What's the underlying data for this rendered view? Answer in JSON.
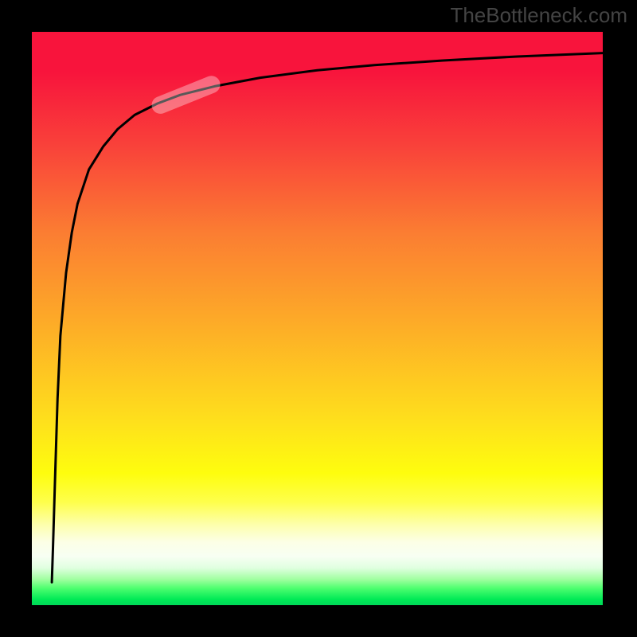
{
  "watermark": "TheBottleneck.com",
  "colors": {
    "frame": "#000000",
    "curve": "#000000",
    "highlight": "rgba(255,255,255,0.35)",
    "gradient_top": "#f8143c",
    "gradient_mid1": "#fb7d32",
    "gradient_mid2": "#fee01c",
    "gradient_bottom": "#00d858",
    "watermark_text": "#444444"
  },
  "chart_data": {
    "type": "line",
    "title": "",
    "xlabel": "",
    "ylabel": "",
    "xlim": [
      0,
      100
    ],
    "ylim": [
      0,
      100
    ],
    "series": [
      {
        "name": "curve",
        "x": [
          3.5,
          3.7,
          4.0,
          4.5,
          5.0,
          6.0,
          7.0,
          8.0,
          10.0,
          12.5,
          15.0,
          18.0,
          22.0,
          26.0,
          32.0,
          40.0,
          50.0,
          60.0,
          72.0,
          85.0,
          100.0
        ],
        "y": [
          4.0,
          10.0,
          20.0,
          36.0,
          47.0,
          58.0,
          65.0,
          70.0,
          76.0,
          80.0,
          83.0,
          85.5,
          87.5,
          89.0,
          90.5,
          92.0,
          93.3,
          94.2,
          95.0,
          95.7,
          96.3
        ]
      }
    ],
    "highlight_region": {
      "x_start": 22,
      "x_end": 32,
      "y_start": 87,
      "y_end": 91
    },
    "background_gradient_axis": "y",
    "background_gradient_stops": [
      {
        "value": 100,
        "color": "#f8143c"
      },
      {
        "value": 65,
        "color": "#fb7d32"
      },
      {
        "value": 35,
        "color": "#fee01c"
      },
      {
        "value": 15,
        "color": "#feff4b"
      },
      {
        "value": 5,
        "color": "#a0ffa0"
      },
      {
        "value": 0,
        "color": "#00d858"
      }
    ]
  }
}
